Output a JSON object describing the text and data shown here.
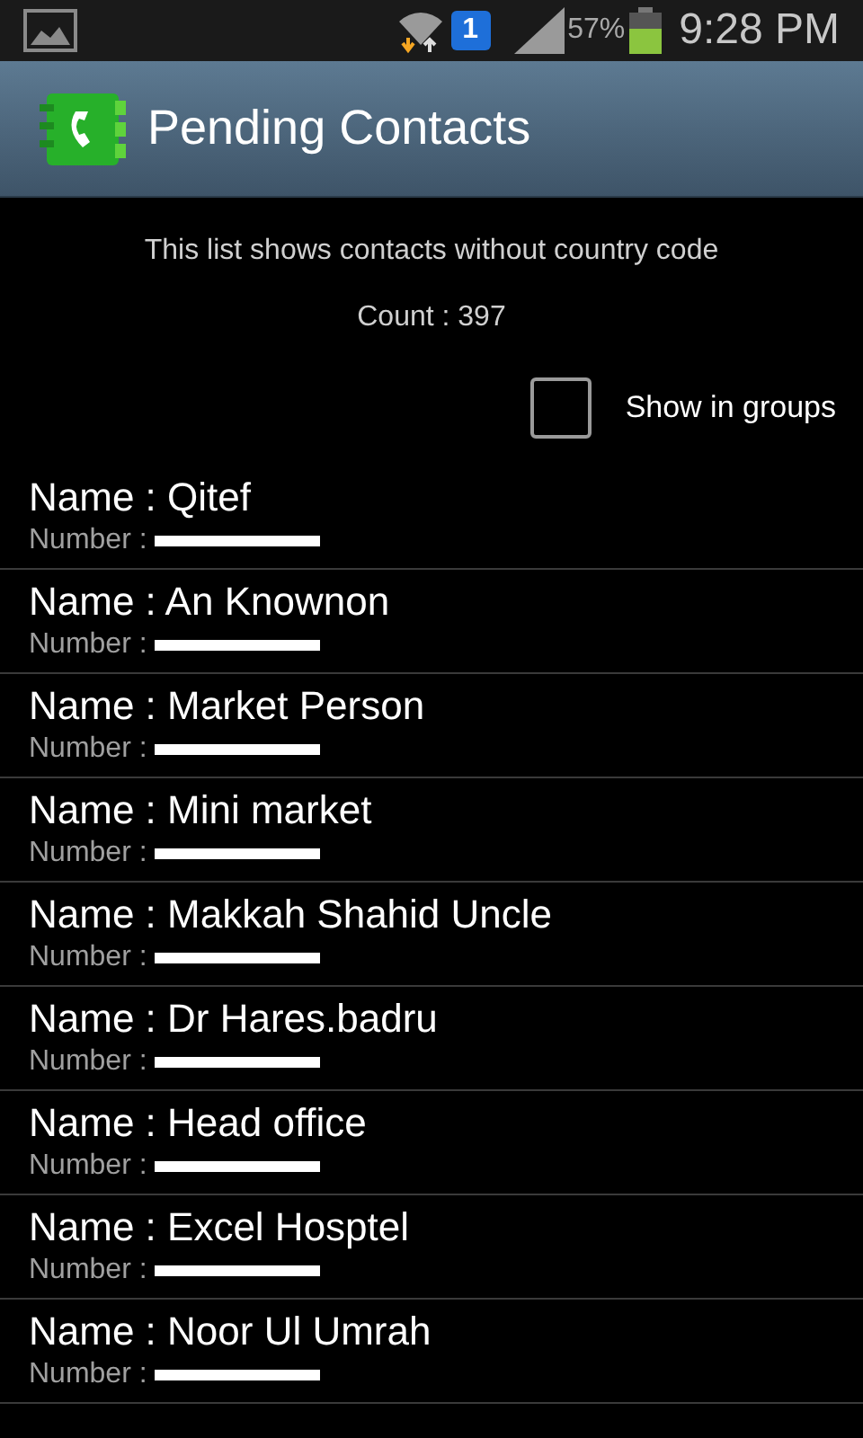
{
  "status_bar": {
    "battery": "57%",
    "time": "9:28 PM",
    "sim": "1"
  },
  "title_bar": {
    "title": "Pending Contacts"
  },
  "info": {
    "description": "This list shows contacts without country code",
    "count": "Count : 397"
  },
  "show_in_groups": {
    "label": "Show in groups",
    "checked": false
  },
  "contacts": [
    {
      "name": "Name : Qitef",
      "number_label": "Number :"
    },
    {
      "name": "Name : An Knownon",
      "number_label": "Number :"
    },
    {
      "name": "Name : Market Person",
      "number_label": "Number :"
    },
    {
      "name": "Name : Mini market",
      "number_label": "Number :"
    },
    {
      "name": "Name : Makkah Shahid Uncle",
      "number_label": "Number :"
    },
    {
      "name": "Name : Dr Hares.badru",
      "number_label": "Number :"
    },
    {
      "name": "Name : Head office",
      "number_label": "Number :"
    },
    {
      "name": "Name : Excel Hosptel",
      "number_label": "Number :"
    },
    {
      "name": "Name : Noor Ul Umrah",
      "number_label": "Number :"
    }
  ]
}
